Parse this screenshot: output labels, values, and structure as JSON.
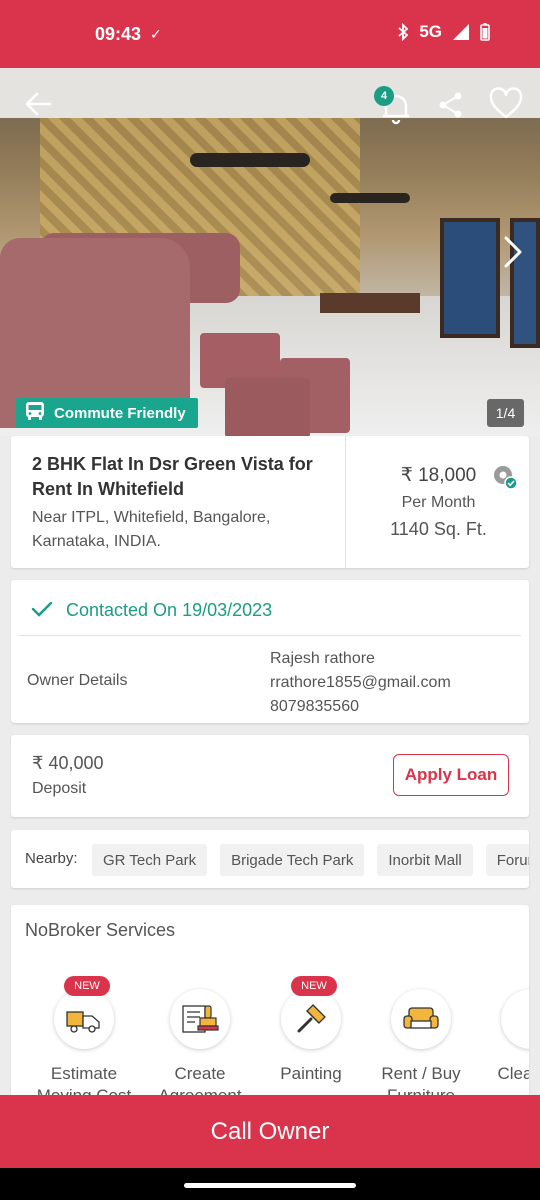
{
  "status_bar": {
    "time": "09:43",
    "network": "5G"
  },
  "listing": {
    "notification_count": "4",
    "commute_tag": "Commute Friendly",
    "photo_counter": "1/4",
    "title": "2 BHK Flat In Dsr Green Vista for Rent In Whitefield",
    "address": "Near ITPL, Whitefield, Bangalore, Karnataka, INDIA.",
    "rent": "₹ 18,000",
    "rent_label": "Per Month",
    "area": "1140 Sq. Ft."
  },
  "contact": {
    "status": "Contacted On 19/03/2023",
    "owner_label": "Owner Details",
    "owner_name": "Rajesh rathore",
    "owner_email": "rrathore1855@gmail.com",
    "owner_phone": "8079835560"
  },
  "deposit": {
    "value": "₹ 40,000",
    "label": "Deposit",
    "apply_loan": "Apply Loan"
  },
  "nearby": {
    "label": "Nearby:",
    "places": [
      "GR Tech Park",
      "Brigade Tech Park",
      "Inorbit Mall",
      "Forum"
    ]
  },
  "services": {
    "title": "NoBroker Services",
    "new_badge": "NEW",
    "items": [
      {
        "label": "Estimate Moving Cost",
        "icon": "truck-icon"
      },
      {
        "label": "Create Agreement",
        "icon": "stamp-icon"
      },
      {
        "label": "Painting",
        "icon": "paint-brush-icon"
      },
      {
        "label": "Rent / Buy Furniture",
        "icon": "sofa-icon"
      },
      {
        "label": "Cleaning",
        "icon": "cleaning-icon"
      }
    ]
  },
  "cta": {
    "call_owner": "Call Owner"
  },
  "colors": {
    "brand": "#d9344b",
    "accent": "#1b9c85"
  }
}
